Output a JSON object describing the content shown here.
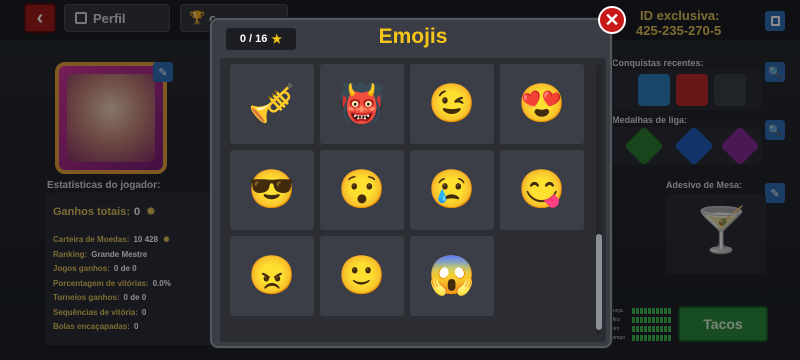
{
  "background": {
    "tabs": [
      {
        "label": "Perfil",
        "icon": "id-card-icon"
      },
      {
        "label": "c",
        "icon": "trophy-icon"
      }
    ],
    "id_label": "ID exclusiva:",
    "id_value": "425-235-270-5",
    "stats_title": "Estatísticas do jogador:",
    "stats": [
      {
        "label": "Ganhos totais:",
        "value": "0"
      },
      {
        "label": "Carteira de Moedas:",
        "value": "10 428"
      },
      {
        "label": "Ranking:",
        "value": "Grande Mestre"
      },
      {
        "label": "Jogos ganhos:",
        "value": "0 de 0"
      },
      {
        "label": "Porcentagem de vitórias:",
        "value": "0.0%"
      },
      {
        "label": "Torneios ganhos:",
        "value": "0 de 0"
      },
      {
        "label": "Sequências de vitória:",
        "value": "0"
      },
      {
        "label": "Bolas encaçapadas:",
        "value": "0"
      }
    ],
    "recent_achievements_label": "Conquistas recentes:",
    "league_medals_label": "Medalhas de liga:",
    "table_sticker_label": "Adesivo de Mesa:",
    "cue_stats": [
      {
        "label": "Força",
        "level": 10
      },
      {
        "label": "Mira",
        "level": 10
      },
      {
        "label": "Giro",
        "level": 10
      },
      {
        "label": "Tempo",
        "level": 10
      }
    ],
    "cue_button": "Tacos",
    "colors": {
      "gold": "#e5c45a",
      "blue_button": "#2f6fb8",
      "green_button": "#2c8a3c"
    }
  },
  "modal": {
    "title": "Emojis",
    "counter": "0 / 16",
    "counter_icon": "star-icon",
    "close_icon": "close-icon",
    "emojis": [
      {
        "name": "mariachi-trumpet-emoji",
        "icon": "🎺"
      },
      {
        "name": "green-monster-emoji",
        "icon": "👹"
      },
      {
        "name": "winking-face-emoji",
        "icon": "😉"
      },
      {
        "name": "heart-eyes-emoji",
        "icon": "😍"
      },
      {
        "name": "sunglasses-face-emoji",
        "icon": "😎"
      },
      {
        "name": "surprised-face-emoji",
        "icon": "😯"
      },
      {
        "name": "crying-face-emoji",
        "icon": "😢"
      },
      {
        "name": "tongue-out-emoji",
        "icon": "😋"
      },
      {
        "name": "angry-face-emoji",
        "icon": "😠"
      },
      {
        "name": "smiling-face-emoji",
        "icon": "🙂"
      },
      {
        "name": "screaming-face-emoji",
        "icon": "😱"
      }
    ],
    "colors": {
      "title": "#f5c518",
      "close": "#c91818",
      "cell": "#3b3e46"
    }
  }
}
